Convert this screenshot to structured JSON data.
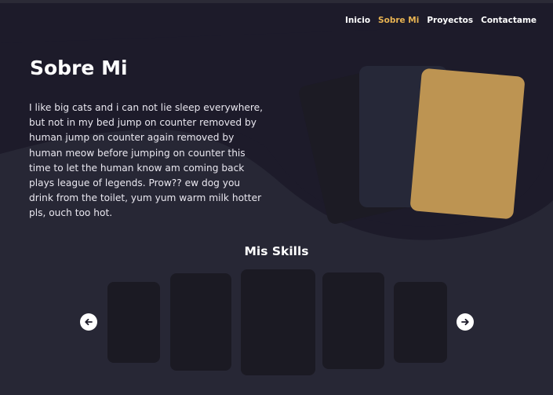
{
  "nav": {
    "items": [
      {
        "label": "Inicio",
        "active": false
      },
      {
        "label": "Sobre Mi",
        "active": true
      },
      {
        "label": "Proyectos",
        "active": false
      },
      {
        "label": "Contactame",
        "active": false
      }
    ]
  },
  "about": {
    "title": "Sobre Mi",
    "text": "I like big cats and i can not lie sleep everywhere, but not in my bed jump on counter removed by human jump on counter again removed by human meow before jumping on counter this time to let the human know am coming back plays league of legends. Prow?? ew dog you drink from the toilet, yum yum warm milk hotter pls, ouch too hot."
  },
  "skills": {
    "title": "Mis Skills",
    "prev_icon": "arrow-left-icon",
    "next_icon": "arrow-right-icon"
  },
  "colors": {
    "background": "#1d1b2a",
    "wave": "#272735",
    "accent": "#e8b352",
    "card_gold": "#bd9452",
    "card_dark": "#1b1a23"
  }
}
